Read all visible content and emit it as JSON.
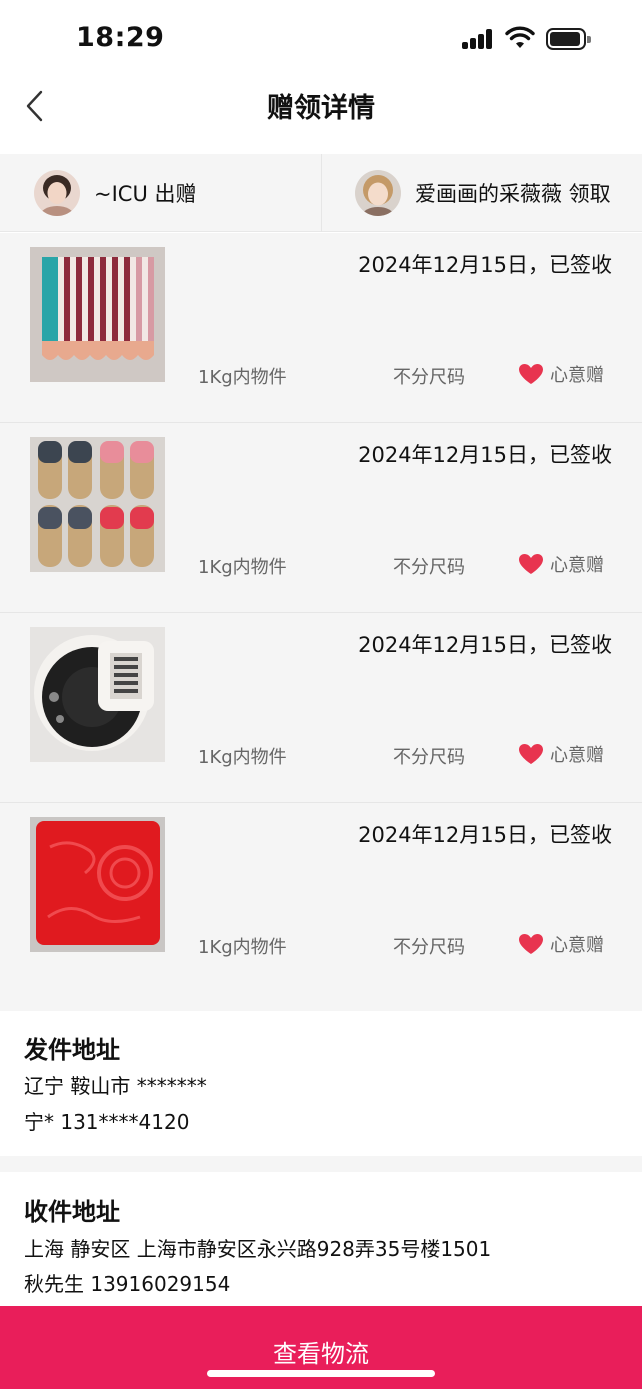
{
  "status_bar": {
    "time": "18:29"
  },
  "nav": {
    "title": "赠领详情",
    "back_icon": "chevron-left-icon"
  },
  "users": {
    "giver": {
      "name": "~ICU 出赠"
    },
    "receiver": {
      "name": "爱画画的采薇薇 领取"
    }
  },
  "gifts": [
    {
      "status": "2024年12月15日，已签收",
      "weight": "1Kg内物件",
      "size": "不分尺码",
      "tag": "心意赠"
    },
    {
      "status": "2024年12月15日，已签收",
      "weight": "1Kg内物件",
      "size": "不分尺码",
      "tag": "心意赠"
    },
    {
      "status": "2024年12月15日，已签收",
      "weight": "1Kg内物件",
      "size": "不分尺码",
      "tag": "心意赠"
    },
    {
      "status": "2024年12月15日，已签收",
      "weight": "1Kg内物件",
      "size": "不分尺码",
      "tag": "心意赠"
    }
  ],
  "sender_address": {
    "title": "发件地址",
    "line1": "辽宁 鞍山市 *******",
    "line2": "宁* 131****4120"
  },
  "receiver_address": {
    "title": "收件地址",
    "line1": "上海 静安区 上海市静安区永兴路928弄35号楼1501",
    "line2": "秋先生 13916029154"
  },
  "action": {
    "label": "查看物流"
  },
  "colors": {
    "accent": "#e91e5a",
    "heart": "#e8344f",
    "list_bg": "#f5f5f5"
  }
}
